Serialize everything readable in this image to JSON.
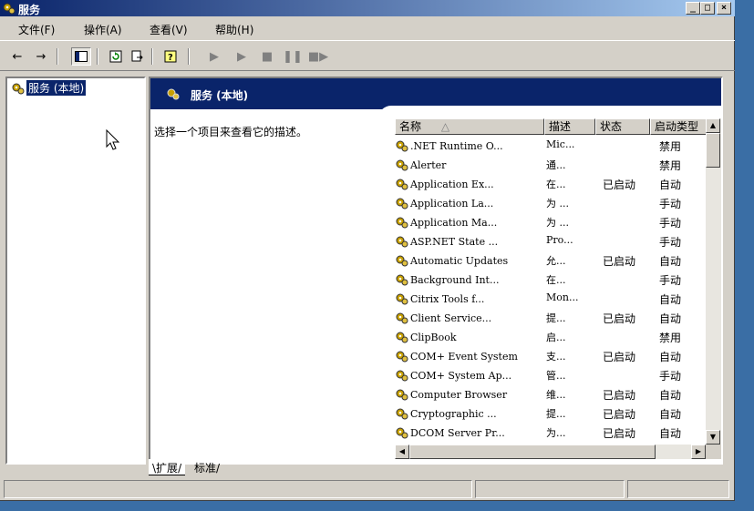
{
  "window": {
    "title": "服务",
    "controls": [
      "_",
      "□",
      "×"
    ]
  },
  "menu": [
    "文件(F)",
    "操作(A)",
    "查看(V)",
    "帮助(H)"
  ],
  "toolbar": {
    "icons": [
      "back-icon",
      "forward-icon",
      "show-hide-tree-icon",
      "refresh-icon",
      "export-list-icon",
      "help-icon",
      "start-service-icon",
      "start-service-alt-icon",
      "stop-service-icon",
      "pause-service-icon",
      "restart-service-icon"
    ]
  },
  "tree": {
    "selected": "服务 (本地)"
  },
  "pane": {
    "title": "服务 (本地)",
    "description": "选择一个项目来查看它的描述。"
  },
  "list": {
    "columns": [
      "名称",
      "描述",
      "状态",
      "启动类型"
    ],
    "rows": [
      {
        "name": ".NET Runtime O...",
        "desc": "Mic...",
        "status": "",
        "startup": "禁用"
      },
      {
        "name": "Alerter",
        "desc": "通...",
        "status": "",
        "startup": "禁用"
      },
      {
        "name": "Application Ex...",
        "desc": "在...",
        "status": "已启动",
        "startup": "自动"
      },
      {
        "name": "Application La...",
        "desc": "为 ...",
        "status": "",
        "startup": "手动"
      },
      {
        "name": "Application Ma...",
        "desc": "为 ...",
        "status": "",
        "startup": "手动"
      },
      {
        "name": "ASP.NET State ...",
        "desc": "Pro...",
        "status": "",
        "startup": "手动"
      },
      {
        "name": "Automatic Updates",
        "desc": "允...",
        "status": "已启动",
        "startup": "自动"
      },
      {
        "name": "Background Int...",
        "desc": "在...",
        "status": "",
        "startup": "手动"
      },
      {
        "name": "Citrix Tools f...",
        "desc": "Mon...",
        "status": "",
        "startup": "自动"
      },
      {
        "name": "Client Service...",
        "desc": "提...",
        "status": "已启动",
        "startup": "自动"
      },
      {
        "name": "ClipBook",
        "desc": "启...",
        "status": "",
        "startup": "禁用"
      },
      {
        "name": "COM+ Event System",
        "desc": "支...",
        "status": "已启动",
        "startup": "自动"
      },
      {
        "name": "COM+ System Ap...",
        "desc": "管...",
        "status": "",
        "startup": "手动"
      },
      {
        "name": "Computer Browser",
        "desc": "维...",
        "status": "已启动",
        "startup": "自动"
      },
      {
        "name": "Cryptographic ...",
        "desc": "提...",
        "status": "已启动",
        "startup": "自动"
      },
      {
        "name": "DCOM Server Pr...",
        "desc": "为...",
        "status": "已启动",
        "startup": "自动"
      }
    ]
  },
  "tabs": [
    "扩展",
    "标准"
  ],
  "colors": {
    "title_gradient_start": "#0a246a",
    "title_gradient_end": "#a6caf0",
    "face": "#d4d0c8",
    "desktop": "#3a6ea5"
  }
}
